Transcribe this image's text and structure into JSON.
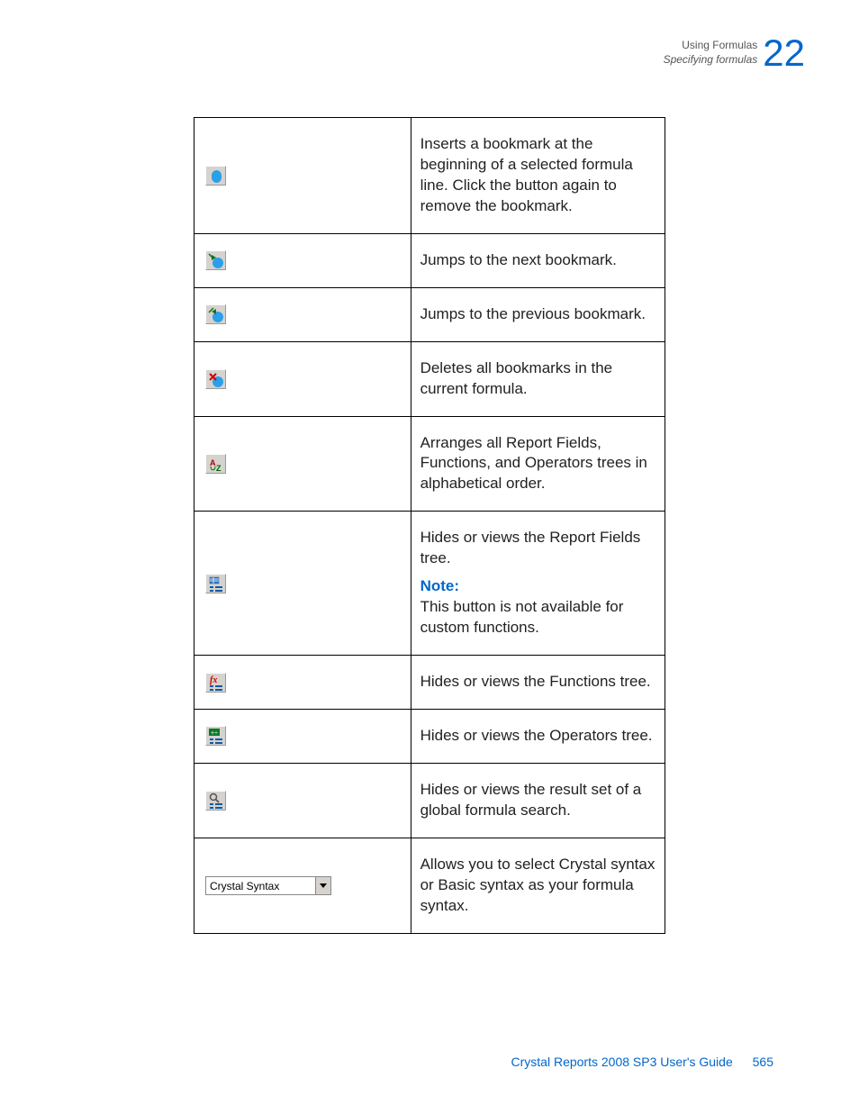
{
  "header": {
    "line1": "Using Formulas",
    "line2": "Specifying formulas",
    "chapter_number": "22"
  },
  "rows": [
    {
      "icon_name": "toggle-bookmark-icon",
      "description": "Inserts a bookmark at the beginning of a selected formula line. Click the button again to remove the bookmark."
    },
    {
      "icon_name": "next-bookmark-icon",
      "description": "Jumps to the next bookmark."
    },
    {
      "icon_name": "previous-bookmark-icon",
      "description": "Jumps to the previous bookmark."
    },
    {
      "icon_name": "delete-bookmarks-icon",
      "description": "Deletes all bookmarks in the current formula."
    },
    {
      "icon_name": "sort-alpha-icon",
      "description": "Arranges all Report Fields, Functions, and Operators trees in alphabetical order."
    },
    {
      "icon_name": "toggle-fields-tree-icon",
      "description": "Hides or views the Report Fields tree.",
      "note_label": "Note:",
      "note_text": "This button is not available for custom functions."
    },
    {
      "icon_name": "toggle-functions-tree-icon",
      "description": "Hides or views the Functions tree."
    },
    {
      "icon_name": "toggle-operators-tree-icon",
      "description": "Hides or views the Operators tree."
    },
    {
      "icon_name": "toggle-result-set-icon",
      "description": "Hides or views the result set of a global formula search."
    },
    {
      "icon_name": "syntax-select",
      "select_value": "Crystal Syntax",
      "description": "Allows you to select Crystal syntax or Basic syntax as your formula syntax."
    }
  ],
  "footer": {
    "title": "Crystal Reports 2008 SP3 User's Guide",
    "page": "565"
  }
}
